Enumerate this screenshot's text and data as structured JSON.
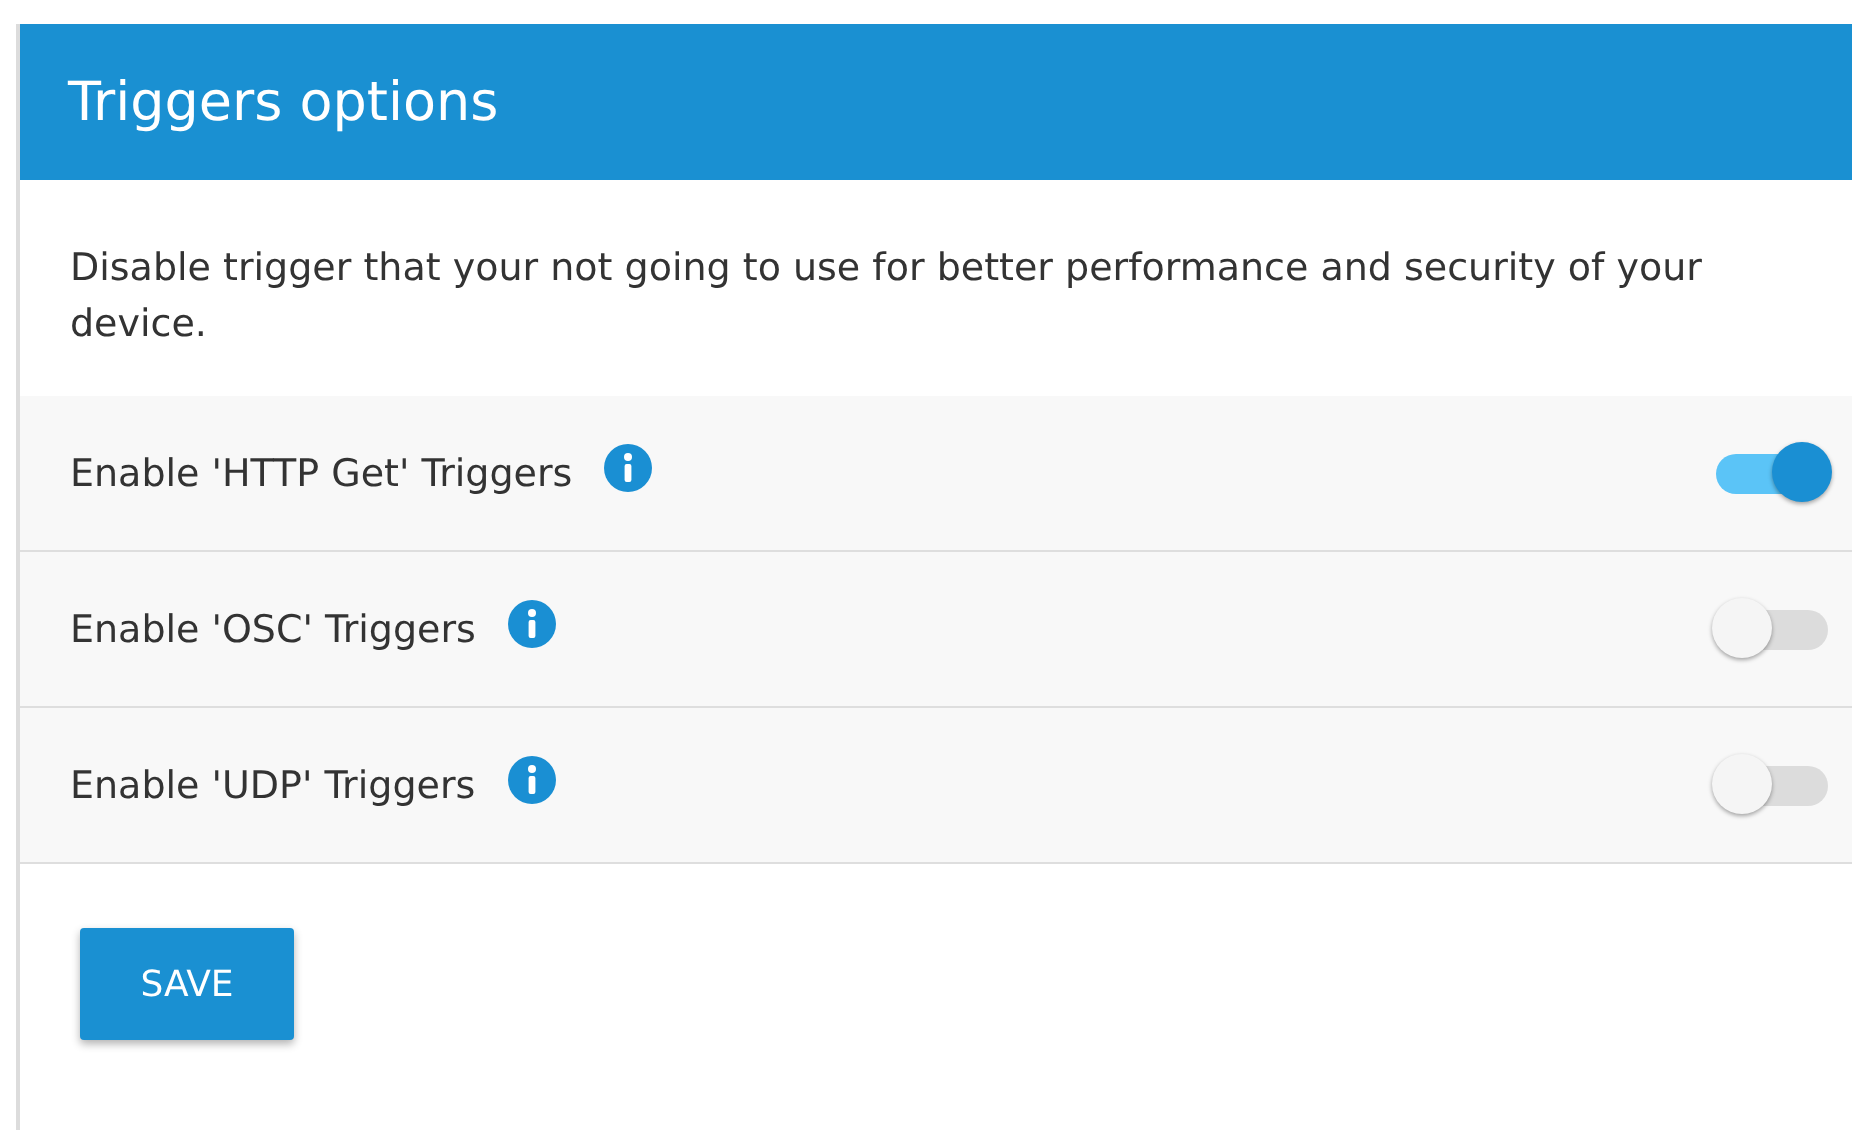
{
  "panel": {
    "title": "Triggers options",
    "description": "Disable trigger that your not going to use for better performance and security of your device.",
    "options": [
      {
        "label": "Enable 'HTTP Get' Triggers",
        "on": true
      },
      {
        "label": "Enable 'OSC' Triggers",
        "on": false
      },
      {
        "label": "Enable 'UDP' Triggers",
        "on": false
      }
    ],
    "buttons": [
      "SAVE"
    ]
  }
}
